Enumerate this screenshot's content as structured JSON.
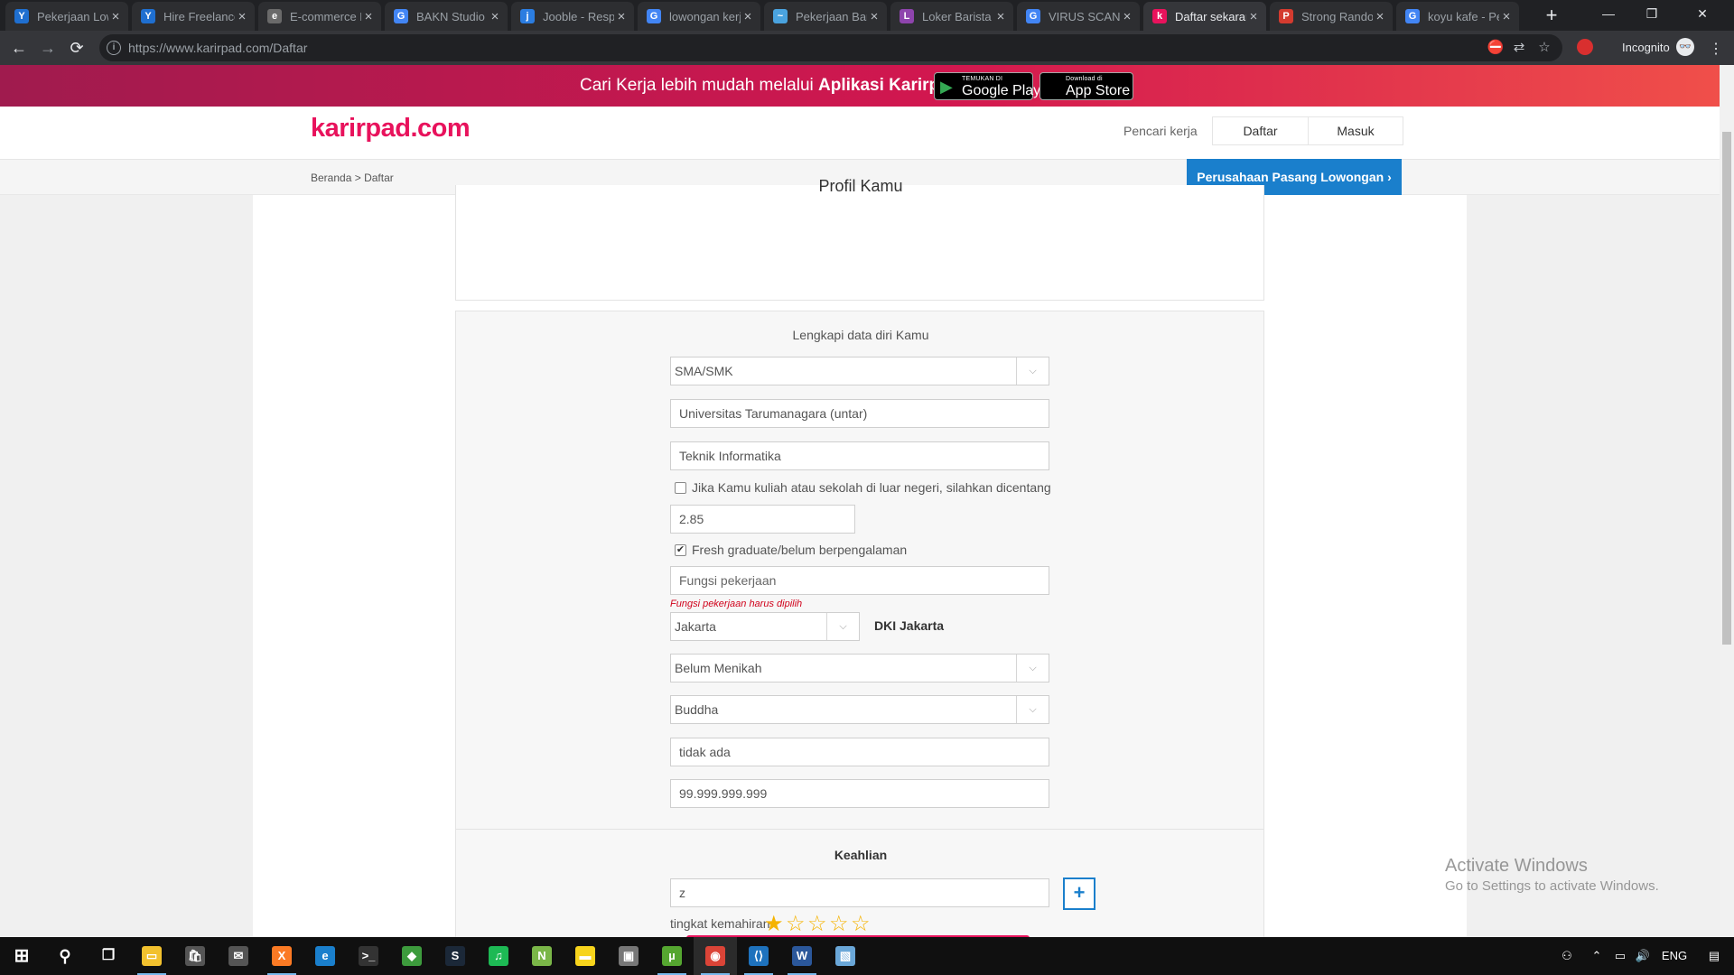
{
  "browser": {
    "tabs": [
      {
        "title": "Pekerjaan Lowongan",
        "favicon": "Y",
        "color": "#1f6fd0"
      },
      {
        "title": "Hire Freelancers",
        "favicon": "Y",
        "color": "#1f6fd0"
      },
      {
        "title": "E-commerce Platform",
        "favicon": "e",
        "color": "#6a6a6a"
      },
      {
        "title": "BAKN Studio - Google",
        "favicon": "G",
        "color": "#4285f4"
      },
      {
        "title": "Jooble - Responsive",
        "favicon": "j",
        "color": "#2b7de1"
      },
      {
        "title": "lowongan kerja",
        "favicon": "G",
        "color": "#4285f4"
      },
      {
        "title": "Pekerjaan Barista",
        "favicon": "~",
        "color": "#4aa3df"
      },
      {
        "title": "Loker Barista Jakarta",
        "favicon": "L",
        "color": "#8e44ad"
      },
      {
        "title": "VIRUS SCANNER",
        "favicon": "G",
        "color": "#4285f4"
      },
      {
        "title": "Daftar sekarang",
        "favicon": "k",
        "color": "#e8125c"
      },
      {
        "title": "Strong Random",
        "favicon": "P",
        "color": "#d43b2f"
      },
      {
        "title": "koyu kafe - Penelusuran",
        "favicon": "G",
        "color": "#4285f4"
      }
    ],
    "close_glyph": "×",
    "new_tab": "+",
    "window_controls": [
      "—",
      "❐",
      "✕"
    ],
    "back": "←",
    "forward": "→",
    "reload": "⟳",
    "url": "https://www.karirpad.com/Daftar",
    "info_glyph": "i",
    "omni_icons": [
      "⛔",
      "⇄",
      "☆"
    ],
    "incognito": "Incognito",
    "incognito_glyph": "👓",
    "menu_glyph": "⋮"
  },
  "promo": {
    "text_prefix": "Cari Kerja lebih mudah melalui ",
    "text_bold": "Aplikasi Karirpad",
    "google_play": {
      "small": "TEMUKAN DI",
      "big": "Google Play",
      "icon": "▶"
    },
    "app_store": {
      "small": "Download di",
      "big": "App Store",
      "icon": ""
    }
  },
  "header": {
    "logo": "karirpad.com",
    "nav_seeker": "Pencari kerja",
    "daftar": "Daftar",
    "masuk": "Masuk"
  },
  "breadcrumb": {
    "home": "Beranda",
    "sep": " > ",
    "current": "Daftar"
  },
  "company_button": "Perusahaan Pasang Lowongan ›",
  "profile": {
    "title": "Profil Kamu"
  },
  "form": {
    "heading": "Lengkapi data diri Kamu",
    "caret": "⌵",
    "education": "SMA/SMK",
    "university": "Universitas Tarumanagara (untar)",
    "major": "Teknik Informatika",
    "abroad_label": "Jika Kamu kuliah atau sekolah di luar negeri, silahkan dicentang",
    "abroad_checked": false,
    "gpa": "2.85",
    "fresh_label": "Fresh graduate/belum berpengalaman",
    "fresh_checked": true,
    "check_mark": "✔",
    "job_function_placeholder": "Fungsi pekerjaan",
    "job_function_error": "Fungsi pekerjaan harus dipilih",
    "city": "Jakarta",
    "province": "DKI Jakarta",
    "marital": "Belum Menikah",
    "religion": "Buddha",
    "field_9": "tidak ada",
    "field_10": "99.999.999.999"
  },
  "skills": {
    "title": "Keahlian",
    "value": "z",
    "add": "+",
    "level_label": "tingkat kemahiran",
    "rating": 1,
    "rating_max": 5,
    "star_filled": "★",
    "star_empty": "☆"
  },
  "watermark": {
    "title": "Activate Windows",
    "subtitle": "Go to Settings to activate Windows."
  },
  "taskbar": {
    "start": "⊞",
    "search": "⚲",
    "task_view": "❐",
    "apps": [
      {
        "name": "file-explorer",
        "glyph": "▭",
        "color": "#f2c12e",
        "running": true
      },
      {
        "name": "store",
        "glyph": "🛍",
        "color": "#555",
        "running": false
      },
      {
        "name": "mail",
        "glyph": "✉",
        "color": "#555",
        "running": false
      },
      {
        "name": "xampp",
        "glyph": "X",
        "color": "#fb7a24",
        "running": true
      },
      {
        "name": "edge",
        "glyph": "e",
        "color": "#1a7fcc",
        "running": false
      },
      {
        "name": "terminal",
        "glyph": ">_",
        "color": "#333",
        "running": false
      },
      {
        "name": "git",
        "glyph": "◆",
        "color": "#3d9b3d",
        "running": false
      },
      {
        "name": "steam",
        "glyph": "S",
        "color": "#1b2838",
        "running": false
      },
      {
        "name": "spotify",
        "glyph": "♫",
        "color": "#1db954",
        "running": false
      },
      {
        "name": "notepad-plus",
        "glyph": "N",
        "color": "#7ab648",
        "running": false
      },
      {
        "name": "sticky-notes",
        "glyph": "▬",
        "color": "#f7d41c",
        "running": false
      },
      {
        "name": "photos",
        "glyph": "▣",
        "color": "#777",
        "running": false
      },
      {
        "name": "utorrent",
        "glyph": "µ",
        "color": "#55a630",
        "running": true
      },
      {
        "name": "chrome",
        "glyph": "◉",
        "color": "#db4437",
        "running": true
      },
      {
        "name": "vscode",
        "glyph": "⟨⟩",
        "color": "#1e72bd",
        "running": true
      },
      {
        "name": "word",
        "glyph": "W",
        "color": "#2b579a",
        "running": true
      },
      {
        "name": "remote",
        "glyph": "▧",
        "color": "#6aa7d8",
        "running": false
      }
    ],
    "tray_people": "⚇",
    "tray_chevron": "⌃",
    "tray_network": "▭",
    "tray_volume": "🔊",
    "language": "ENG",
    "notification": "▤"
  }
}
